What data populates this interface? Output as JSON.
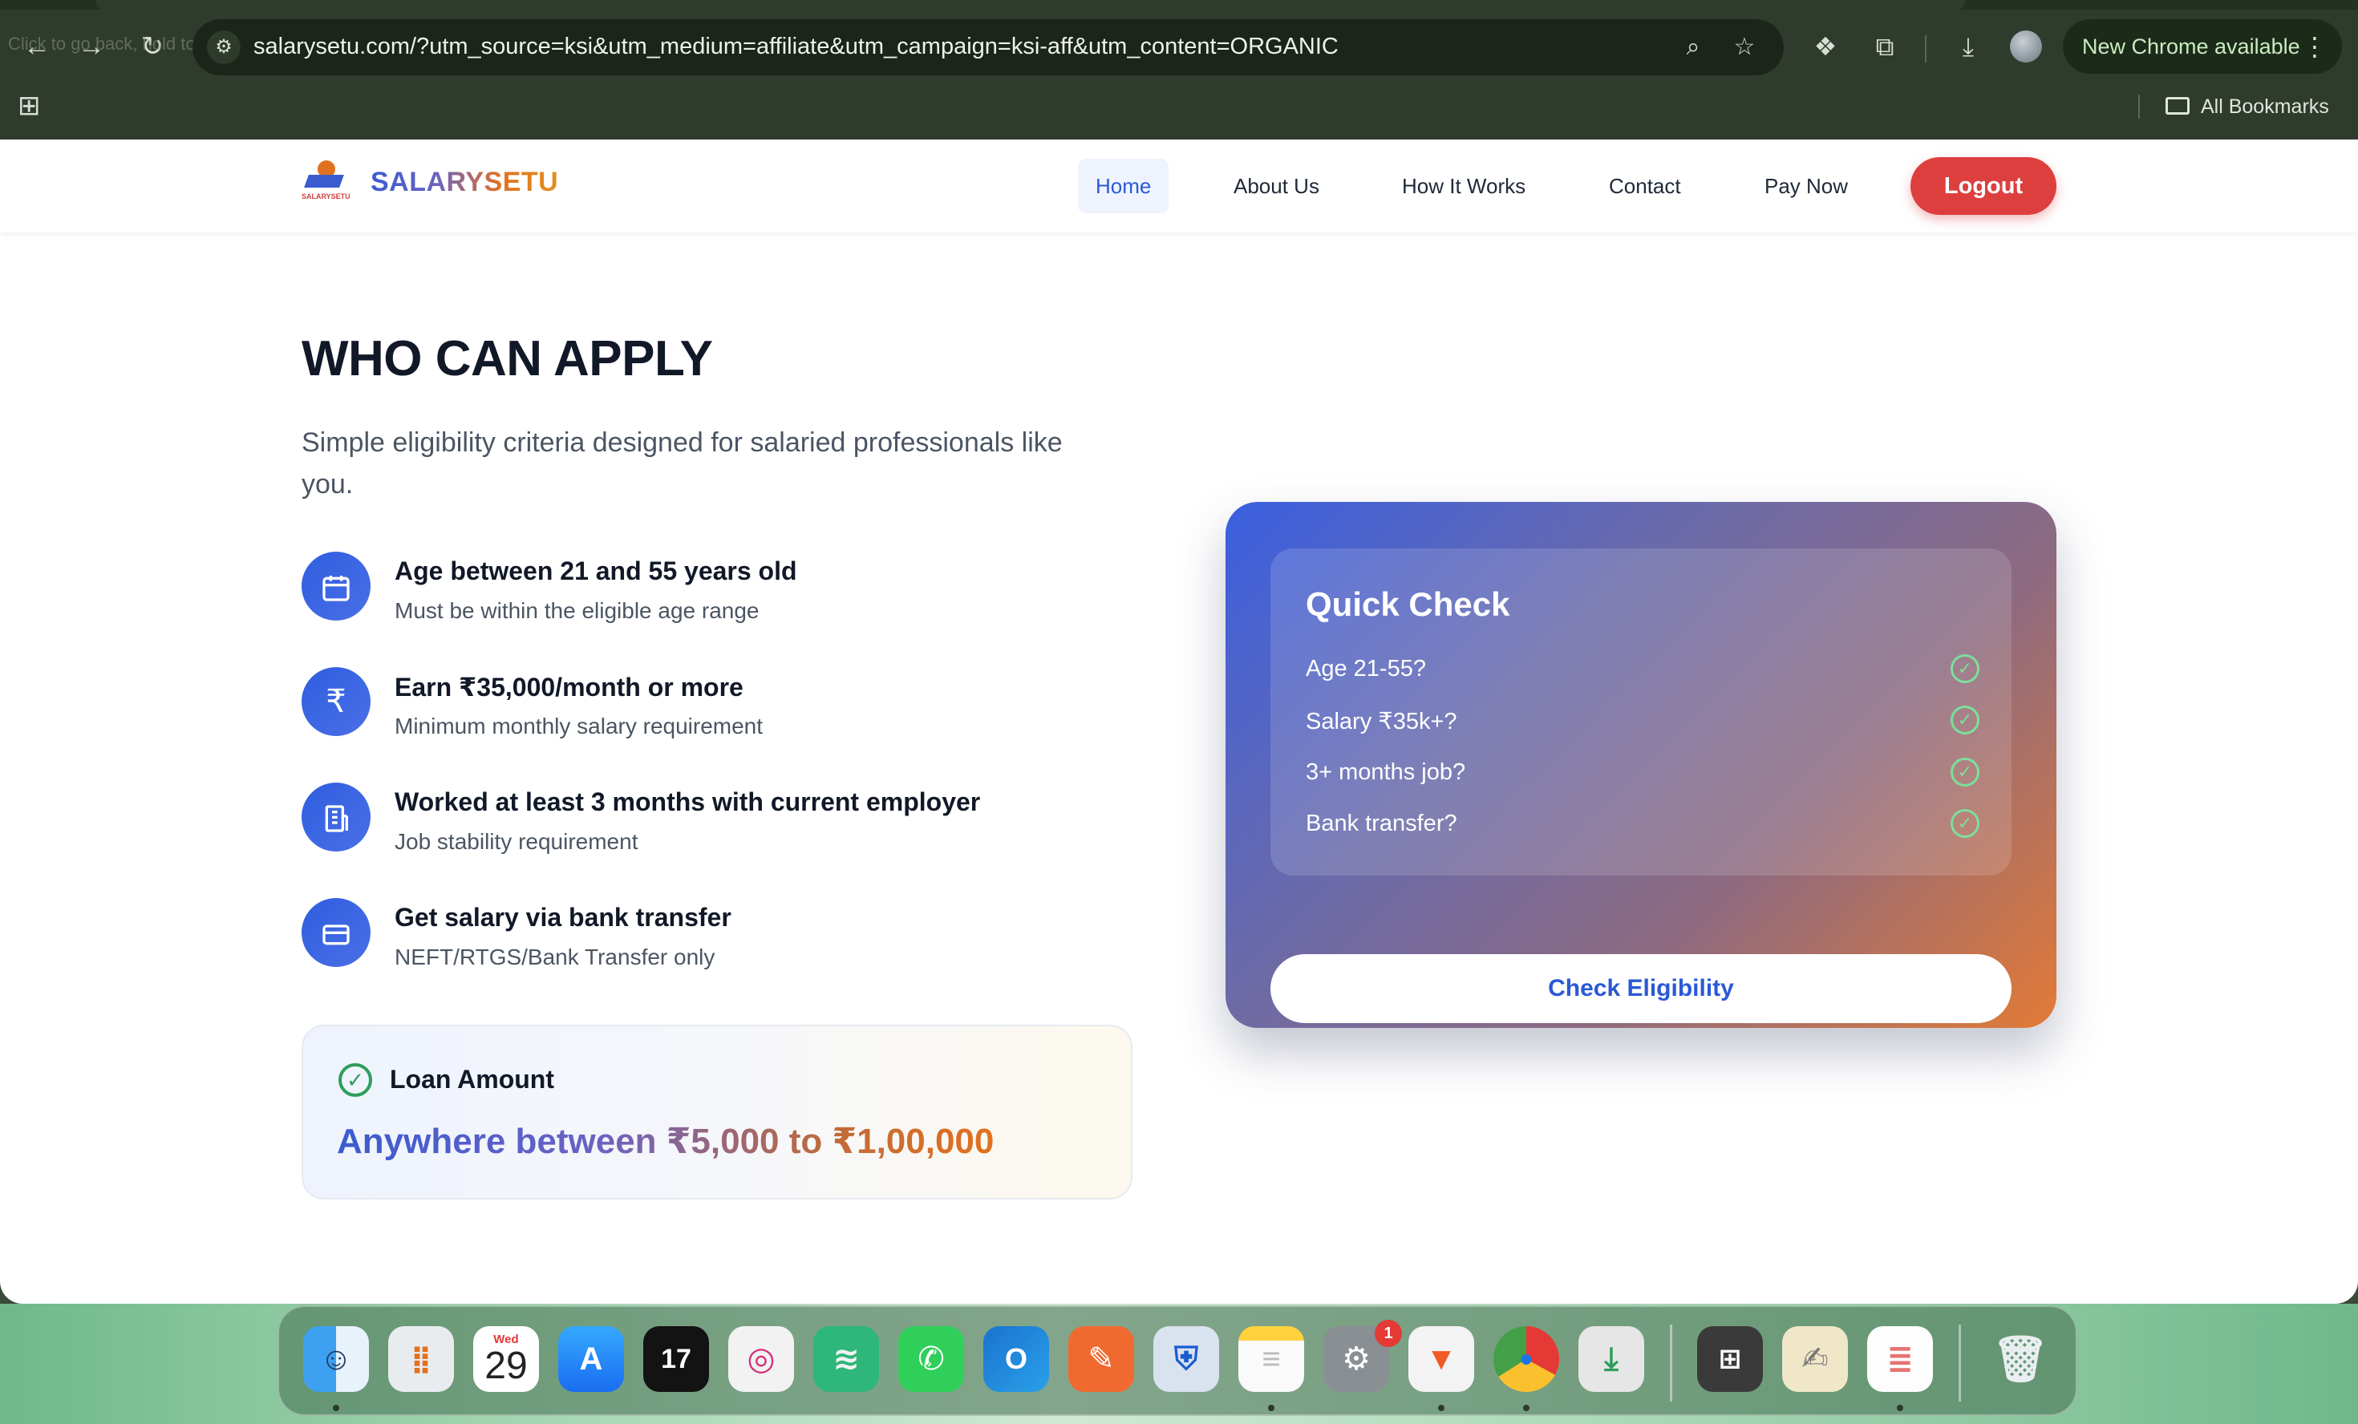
{
  "browser": {
    "back_hint": "Click to go back, hold to see history",
    "url": "salarysetu.com/?utm_source=ksi&utm_medium=affiliate&utm_campaign=ksi-aff&utm_content=ORGANIC",
    "update_label": "New Chrome available",
    "all_bookmarks": "All Bookmarks",
    "icons": [
      "back-arrow-icon",
      "forward-arrow-icon",
      "reload-icon",
      "site-settings-icon",
      "zoom-icon",
      "star-icon",
      "extension-icon",
      "puzzle-icon",
      "download-icon",
      "profile-icon",
      "menu-dots-icon",
      "apps-grid-icon",
      "folder-icon"
    ]
  },
  "site": {
    "logo_mark_text": "SALARYSETU",
    "logo_text": "SALARYSETU",
    "nav": {
      "home": "Home",
      "about": "About Us",
      "how": "How It Works",
      "contact": "Contact",
      "pay": "Pay Now",
      "logout": "Logout"
    },
    "accent_colors": {
      "primary": "#2b59d6",
      "logout": "#dd3f3f",
      "check": "#2e9e5a",
      "orange": "#e2711f"
    }
  },
  "main": {
    "title": "WHO CAN APPLY",
    "lead": "Simple eligibility criteria designed for salaried professionals like you.",
    "criteria": [
      {
        "icon": "calendar-icon",
        "title": "Age between 21 and 55 years old",
        "sub": "Must be within the eligible age range"
      },
      {
        "icon": "rupee-icon",
        "title": "Earn ₹35,000/month or more",
        "sub": "Minimum monthly salary requirement"
      },
      {
        "icon": "building-icon",
        "title": "Worked at least 3 months with current employer",
        "sub": "Job stability requirement"
      },
      {
        "icon": "credit-card-icon",
        "title": "Get salary via bank transfer",
        "sub": "NEFT/RTGS/Bank Transfer only"
      }
    ],
    "loan": {
      "label": "Loan Amount",
      "amount": "Anywhere between ₹5,000 to ₹1,00,000"
    }
  },
  "quick_check": {
    "title": "Quick Check",
    "items": [
      "Age 21-55?",
      "Salary ₹35k+?",
      "3+ months job?",
      "Bank transfer?"
    ],
    "button": "Check Eligibility"
  },
  "dock": {
    "calendar_day": "Wed",
    "calendar_date": "29",
    "settings_badge": "1",
    "apps": [
      "finder-icon",
      "launchpad-icon",
      "calendar-icon",
      "app-store-icon",
      "tradingview-icon",
      "instagram-icon",
      "spotify-icon",
      "whatsapp-icon",
      "outlook-icon",
      "postman-icon",
      "bitwarden-icon",
      "notes-icon",
      "system-settings-icon",
      "brave-icon",
      "chrome-icon",
      "installer-icon",
      "calculator-icon",
      "textedit-icon",
      "notepad-icon",
      "trash-icon"
    ]
  }
}
